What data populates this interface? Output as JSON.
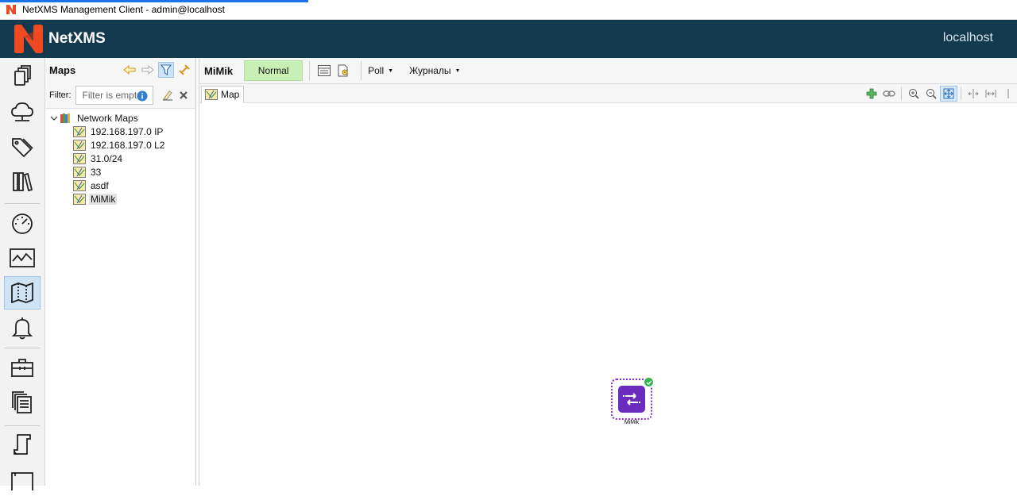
{
  "window": {
    "title": "NetXMS Management Client - admin@localhost"
  },
  "header": {
    "brand": "NetXMS",
    "server": "localhost"
  },
  "rail": {
    "items": [
      {
        "name": "objects-icon",
        "active": false
      },
      {
        "name": "network-icon",
        "active": false
      },
      {
        "name": "tags-icon",
        "active": false
      },
      {
        "name": "library-icon",
        "active": false
      },
      {
        "name": "dashboard-icon",
        "active": false
      },
      {
        "name": "performance-icon",
        "active": false
      },
      {
        "name": "maps-icon",
        "active": true
      },
      {
        "name": "alarms-icon",
        "active": false
      },
      {
        "name": "tools-icon",
        "active": false
      },
      {
        "name": "templates-icon",
        "active": false
      },
      {
        "name": "scripts-icon",
        "active": false
      },
      {
        "name": "more-icon",
        "active": false
      }
    ]
  },
  "navigator": {
    "title": "Maps",
    "filter_label": "Filter:",
    "filter_placeholder": "Filter is empt",
    "tree": {
      "root": "Network Maps",
      "children": [
        "192.168.197.0 IP",
        "192.168.197.0 L2",
        "31.0/24",
        "33",
        "asdf",
        "MiMik"
      ],
      "selected": "MiMik"
    }
  },
  "editor": {
    "object_name": "MiMik",
    "status": "Normal",
    "status_color": "#c8f0b4",
    "menus": [
      "Poll",
      "Журналы"
    ],
    "tab": "Map",
    "node_label": "MiMik"
  }
}
